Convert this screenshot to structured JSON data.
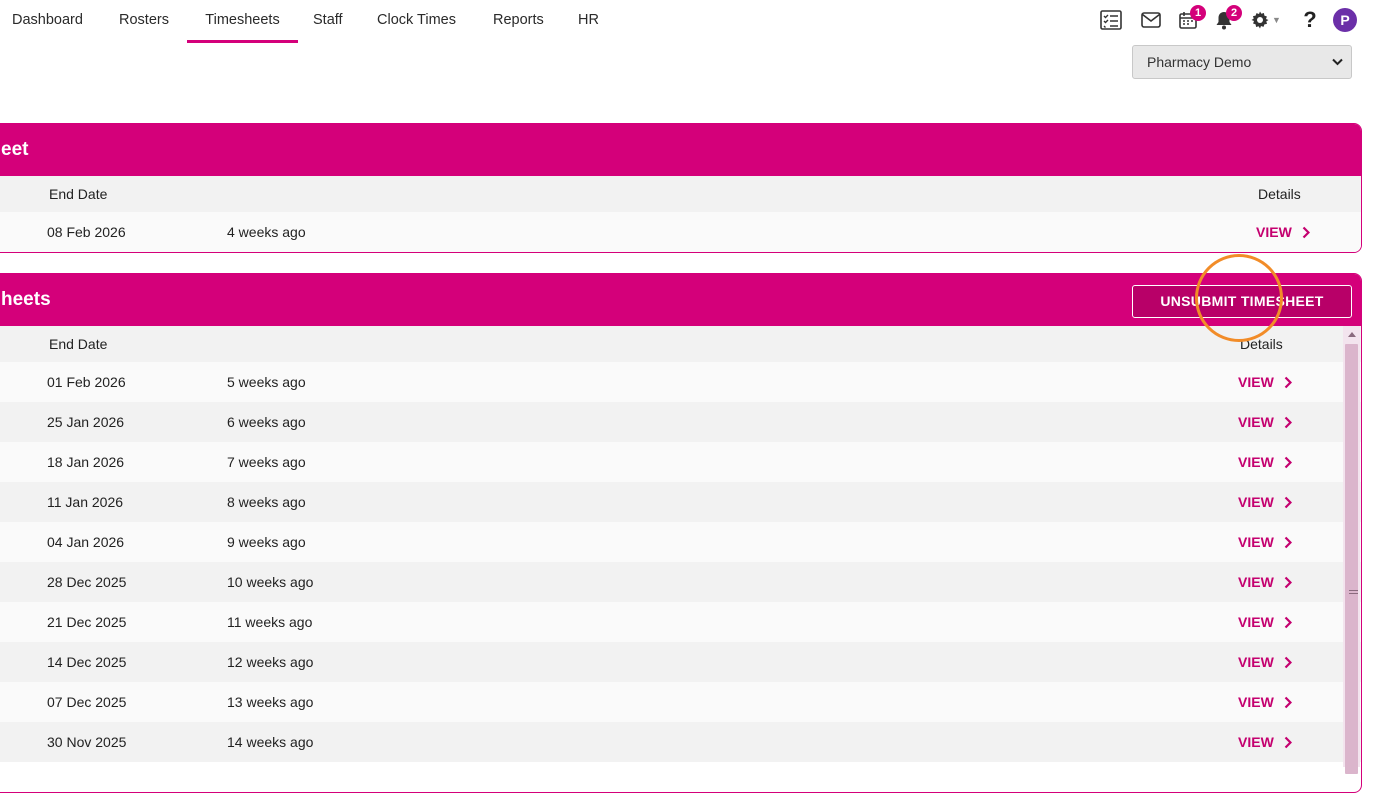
{
  "nav": {
    "tabs": [
      {
        "label": "Dashboard"
      },
      {
        "label": "Rosters"
      },
      {
        "label": "Timesheets"
      },
      {
        "label": "Staff"
      },
      {
        "label": "Clock Times"
      },
      {
        "label": "Reports"
      },
      {
        "label": "HR"
      }
    ],
    "active_tab": "Timesheets",
    "icons": {
      "tasks": "checklist-icon",
      "messages": "mail-icon",
      "calendar": "calendar-icon",
      "notifications": "bell-icon",
      "settings": "gear-icon",
      "help": "help-icon"
    },
    "calendar_badge": "1",
    "notification_badge": "2",
    "avatar_initial": "P"
  },
  "store_select": {
    "selected": "Pharmacy Demo"
  },
  "current_panel": {
    "title": "eet",
    "header_end_date": "End Date",
    "header_details": "Details",
    "rows": [
      {
        "end_date": "08 Feb 2026",
        "relative": "4 weeks ago",
        "action": "VIEW"
      }
    ]
  },
  "submitted_panel": {
    "title": "heets",
    "button_label": "UNSUBMIT TIMESHEET",
    "header_end_date": "End Date",
    "header_details": "Details",
    "rows": [
      {
        "end_date": "01 Feb 2026",
        "relative": "5 weeks ago",
        "action": "VIEW"
      },
      {
        "end_date": "25 Jan 2026",
        "relative": "6 weeks ago",
        "action": "VIEW"
      },
      {
        "end_date": "18 Jan 2026",
        "relative": "7 weeks ago",
        "action": "VIEW"
      },
      {
        "end_date": "11 Jan 2026",
        "relative": "8 weeks ago",
        "action": "VIEW"
      },
      {
        "end_date": "04 Jan 2026",
        "relative": "9 weeks ago",
        "action": "VIEW"
      },
      {
        "end_date": "28 Dec 2025",
        "relative": "10 weeks ago",
        "action": "VIEW"
      },
      {
        "end_date": "21 Dec 2025",
        "relative": "11 weeks ago",
        "action": "VIEW"
      },
      {
        "end_date": "14 Dec 2025",
        "relative": "12 weeks ago",
        "action": "VIEW"
      },
      {
        "end_date": "07 Dec 2025",
        "relative": "13 weeks ago",
        "action": "VIEW"
      },
      {
        "end_date": "30 Nov 2025",
        "relative": "14 weeks ago",
        "action": "VIEW"
      }
    ]
  },
  "colors": {
    "brand": "#d4007a",
    "highlight": "#f28c28",
    "avatar": "#6b2fa8"
  }
}
